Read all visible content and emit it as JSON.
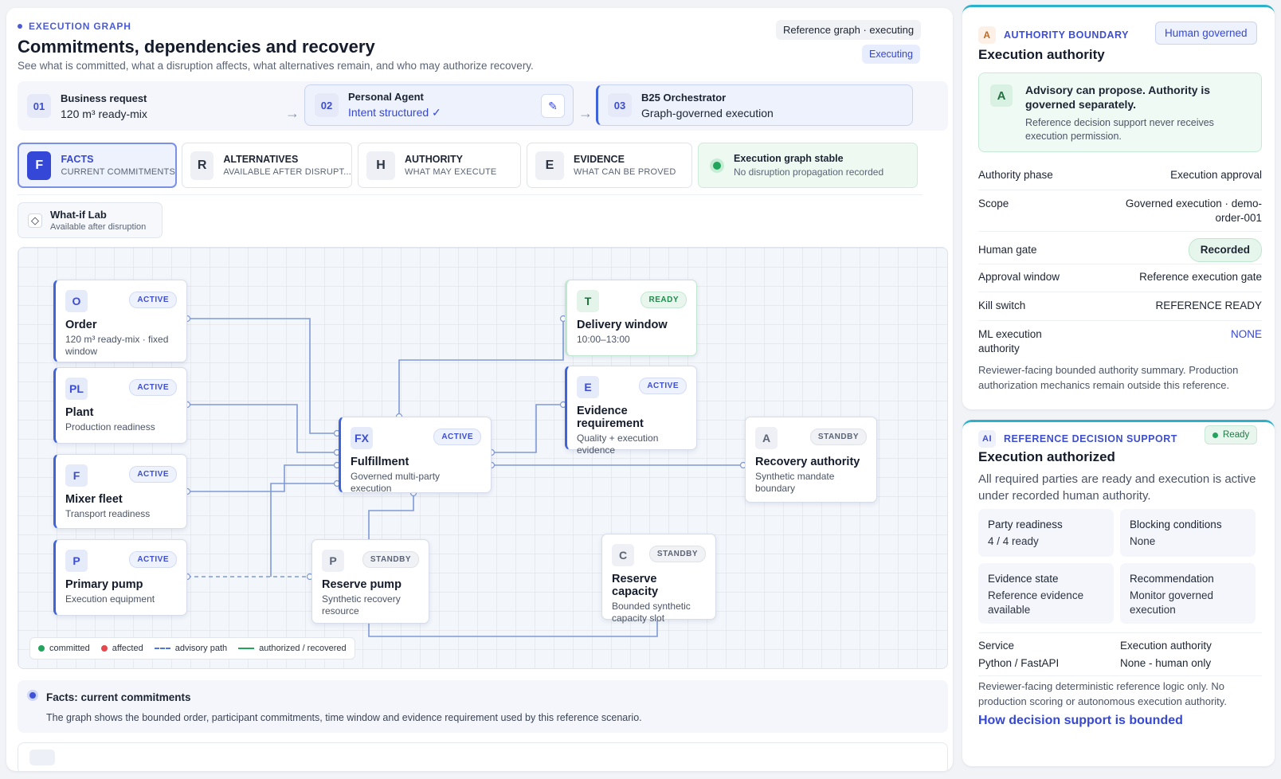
{
  "header": {
    "eyebrow": "EXECUTION GRAPH",
    "title": "Commitments, dependencies and recovery",
    "subtitle": "See what is committed, what a disruption affects, what alternatives remain, and who may authorize recovery.",
    "ref_pill": "Reference graph · executing",
    "status_pill": "Executing"
  },
  "steps": [
    {
      "num": "01",
      "title": "Business request",
      "detail": "120 m³ ready-mix"
    },
    {
      "num": "02",
      "title": "Personal Agent",
      "detail": "Intent structured ✓"
    },
    {
      "num": "03",
      "title": "B25 Orchestrator",
      "detail": "Graph-governed execution"
    }
  ],
  "tabs": [
    {
      "icon": "F",
      "label": "FACTS",
      "sub": "CURRENT COMMITMENTS"
    },
    {
      "icon": "R",
      "label": "ALTERNATIVES",
      "sub": "AVAILABLE AFTER DISRUPT..."
    },
    {
      "icon": "H",
      "label": "AUTHORITY",
      "sub": "WHAT MAY EXECUTE"
    },
    {
      "icon": "E",
      "label": "EVIDENCE",
      "sub": "WHAT CAN BE PROVED"
    }
  ],
  "stable": {
    "title": "Execution graph stable",
    "detail": "No disruption propagation recorded"
  },
  "whatif": {
    "title": "What-if Lab",
    "detail": "Available after disruption"
  },
  "nodes": {
    "order": {
      "icon": "O",
      "badge": "ACTIVE",
      "title": "Order",
      "detail": "120 m³ ready-mix · fixed window"
    },
    "plant": {
      "icon": "PL",
      "badge": "ACTIVE",
      "title": "Plant",
      "detail": "Production readiness"
    },
    "mixer": {
      "icon": "F",
      "badge": "ACTIVE",
      "title": "Mixer fleet",
      "detail": "Transport readiness"
    },
    "pump": {
      "icon": "P",
      "badge": "ACTIVE",
      "title": "Primary pump",
      "detail": "Execution equipment"
    },
    "fulfillment": {
      "icon": "FX",
      "badge": "ACTIVE",
      "title": "Fulfillment",
      "detail": "Governed multi-party execution"
    },
    "reserve_pump": {
      "icon": "P",
      "badge": "STANDBY",
      "title": "Reserve pump",
      "detail": "Synthetic recovery resource"
    },
    "delivery": {
      "icon": "T",
      "badge": "READY",
      "title": "Delivery window",
      "detail": "10:00–13:00"
    },
    "evidence": {
      "icon": "E",
      "badge": "ACTIVE",
      "title": "Evidence requirement",
      "detail": "Quality + execution evidence"
    },
    "recovery": {
      "icon": "A",
      "badge": "STANDBY",
      "title": "Recovery authority",
      "detail": "Synthetic mandate boundary"
    },
    "reserve_cap": {
      "icon": "C",
      "badge": "STANDBY",
      "title": "Reserve capacity",
      "detail": "Bounded synthetic capacity slot"
    }
  },
  "legend": {
    "committed": "committed",
    "affected": "affected",
    "advisory": "advisory path",
    "authorized": "authorized / recovered"
  },
  "facts": {
    "title": "Facts: current commitments",
    "detail": "The graph shows the bounded order, participant commitments, time window and evidence requirement used by this reference scenario."
  },
  "authority": {
    "icon": "A",
    "eyebrow": "AUTHORITY BOUNDARY",
    "pill": "Human governed",
    "title": "Execution authority",
    "advisory_icon": "A",
    "advisory_title": "Advisory can propose. Authority is governed separately.",
    "advisory_detail": "Reference decision support never receives execution permission.",
    "rows": [
      {
        "k": "Authority phase",
        "v": "Execution approval"
      },
      {
        "k": "Scope",
        "v": "Governed execution · demo-order-001"
      },
      {
        "k": "Human gate",
        "v": "Recorded"
      },
      {
        "k": "Approval window",
        "v": "Reference execution gate"
      },
      {
        "k": "Kill switch",
        "v": "REFERENCE READY"
      },
      {
        "k": "ML execution authority",
        "v": "NONE"
      }
    ],
    "footer": "Reviewer-facing bounded authority summary. Production authorization mechanics remain outside this reference."
  },
  "decision": {
    "icon": "AI",
    "eyebrow": "REFERENCE DECISION SUPPORT",
    "pill": "Ready",
    "title": "Execution authorized",
    "detail": "All required parties are ready and execution is active under recorded human authority.",
    "grid": [
      {
        "k": "Party readiness",
        "v": "4 / 4 ready"
      },
      {
        "k": "Blocking conditions",
        "v": "None"
      },
      {
        "k": "Evidence state",
        "v": "Reference evidence available"
      },
      {
        "k": "Recommendation",
        "v": "Monitor governed execution"
      }
    ],
    "service_k": "Service",
    "service_v": "Python / FastAPI",
    "exec_k": "Execution authority",
    "exec_v": "None - human only",
    "footer": "Reviewer-facing deterministic reference logic only. No production scoring or autonomous execution authority.",
    "link": "How decision support is bounded"
  }
}
